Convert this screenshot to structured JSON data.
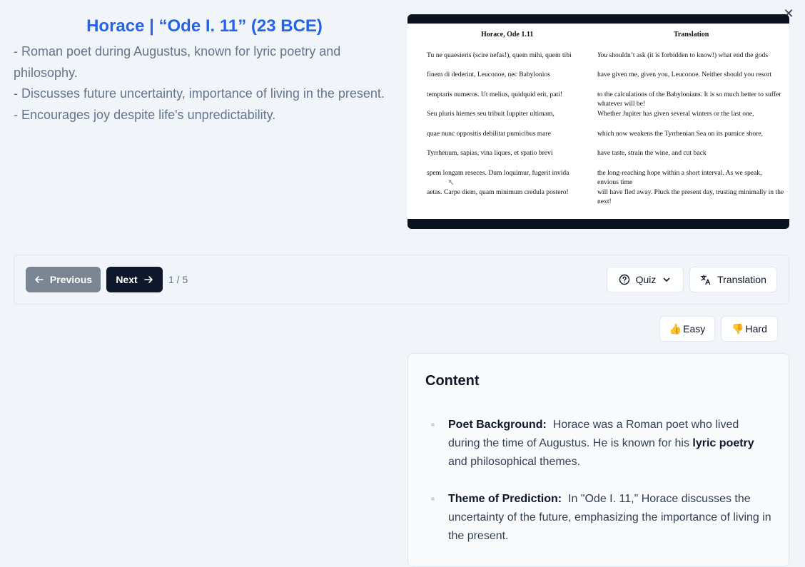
{
  "header": {
    "title": "Horace | “Ode I. 11” (23 BCE)",
    "bullets": [
      "- Roman poet during Augustus, known for lyric poetry and philosophy.",
      "- Discusses future uncertainty, importance of living in the present.",
      "- Encourages joy despite life's unpredictability."
    ]
  },
  "image": {
    "latin_heading": "Horace, Ode 1.11",
    "translation_heading": "Translation",
    "latin_lines": [
      "Tu ne quaesieris (scire nefas!), quem mihi, quem tibi",
      "finem di dederint, Leuconoe, nec Babylonios",
      "temptaris numeros. Ut melius, quidquid erit, pati!",
      "Seu pluris hiemes seu tribuit Iuppiter ultimam,",
      "quae nunc oppositis debilitat pumicibus mare",
      "Tyrrhenum, sapias, vina liques, et spatio brevi",
      "spem longam reseces. Dum loquimur, fugerit invida",
      "aetas. Carpe diem, quam minimum credula postero!"
    ],
    "translation_lines": [
      "shouldn’t ask (it is forbidden to know!) what end the gods",
      "have given me, given you, Leuconoe. Neither should you resort",
      "to the calculations of the Babylonians. It is so much better to suffer whatever will be!",
      "Whether Jupiter has given several winters or the last one,",
      "which now weakens the Tyrrhenian Sea on its pumice shore,",
      "have taste, strain the wine, and cut back",
      "the long-reaching hope within a short interval. As we speak, envious time",
      "will have fled away. Pluck the present day, trusting minimally in the next!"
    ],
    "translation_first_word": "You"
  },
  "toolbar": {
    "previous_label": "Previous",
    "next_label": "Next",
    "page_indicator": "1 / 5",
    "quiz_label": "Quiz",
    "translation_label": "Translation"
  },
  "rating": {
    "easy_label": "Easy",
    "hard_label": "Hard",
    "easy_emoji": "👍",
    "hard_emoji": "👎"
  },
  "content": {
    "title": "Content",
    "items": [
      {
        "label": "Poet Background:",
        "text_before": "Horace was a Roman poet who lived during the time of Augustus. He is known for his",
        "bold": "lyric poetry",
        "text_after": "and philosophical themes."
      },
      {
        "label": "Theme of Prediction:",
        "text_before": "In \"Ode I. 11,\" Horace discusses the uncertainty of the future, emphasizing the importance of living in the present.",
        "bold": "",
        "text_after": ""
      }
    ]
  },
  "colors": {
    "accent": "#2563eb",
    "primary_button": "#0f172a",
    "disabled_button": "#7c8594",
    "background": "#f1f5f9"
  },
  "icons": [
    "close-icon",
    "arrow-left-icon",
    "arrow-right-icon",
    "help-circle-icon",
    "chevron-down-icon",
    "translate-icon",
    "thumbs-up-icon",
    "thumbs-down-icon"
  ]
}
